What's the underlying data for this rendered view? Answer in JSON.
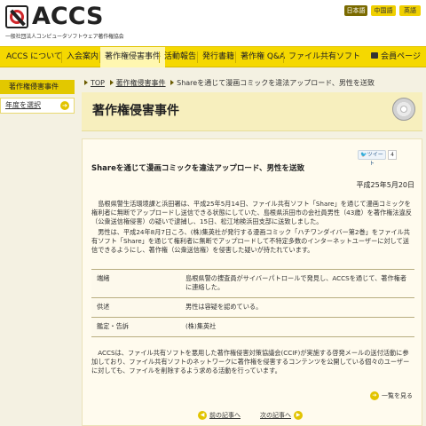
{
  "header": {
    "logo_text": "ACCS",
    "logo_sub": "一般社団法人コンピュータソフトウェア著作権協会",
    "lang_ja": "日本語",
    "lang_zh": "中国語",
    "lang_en": "英語"
  },
  "nav": {
    "items": [
      "ACCS について",
      "入会案内",
      "著作権侵害事件",
      "活動報告",
      "発行書籍",
      "著作権 Q&A",
      "ファイル共有ソフト"
    ],
    "member": "会員ページ",
    "accent": "#f5d800"
  },
  "sidebar": {
    "title": "著作権侵害事件",
    "item": "年度を選択"
  },
  "breadcrumb": {
    "top": "TOP",
    "section": "著作権侵害事件",
    "current": "Shareを通じて漫画コミックを違法アップロード、男性を送致"
  },
  "page": {
    "title": "著作権侵害事件"
  },
  "article": {
    "tweet_label": "ツイート",
    "tweet_count": "4",
    "title": "Shareを通じて漫画コミックを違法アップロード、男性を送致",
    "date": "平成25年5月20日",
    "p1": "　島根県警生活環境課と浜田署は、平成25年5月14日、ファイル共有ソフト「Share」を通じて漫画コミックを権利者に無断でアップロードし送信できる状態にしていた、島根県浜田市の会社員男性（43歳）を著作権法違反（公衆送信権侵害）の疑いで逮捕し、15日、松江地検浜田支部に送致しました。",
    "p2": "　男性は、平成24年8月7日ころ、(株)集英社が発行する漫画コミック「ハチワンダイバー第2巻」をファイル共有ソフト「Share」を通じて権利者に無断でアップロードして不特定多数のインターネットユーザーに対して送信できるようにし、著作権（公衆送信権）を侵害した疑いが持たれています。",
    "table": [
      {
        "key": "端緒",
        "value": "島根県警の捜査員がサイバーパトロールで発見し、ACCSを通じて、著作権者に連絡した。"
      },
      {
        "key": "供述",
        "value": "男性は容疑を認めている。"
      },
      {
        "key": "鑑定・告訴",
        "value": "(株)集英社"
      }
    ],
    "p3": "　ACCSは、ファイル共有ソフトを悪用した著作権侵害対策協議会(CCIF)が実施する啓発メールの送付活動に参加しており、ファイル共有ソフトのネットワークに著作権を侵害するコンテンツを公開している個々のユーザーに対しても、ファイルを削除するよう求める活動を行っています。",
    "list_link": "一覧を見る",
    "prev_link": "前の記事へ",
    "next_link": "次の記事へ"
  }
}
